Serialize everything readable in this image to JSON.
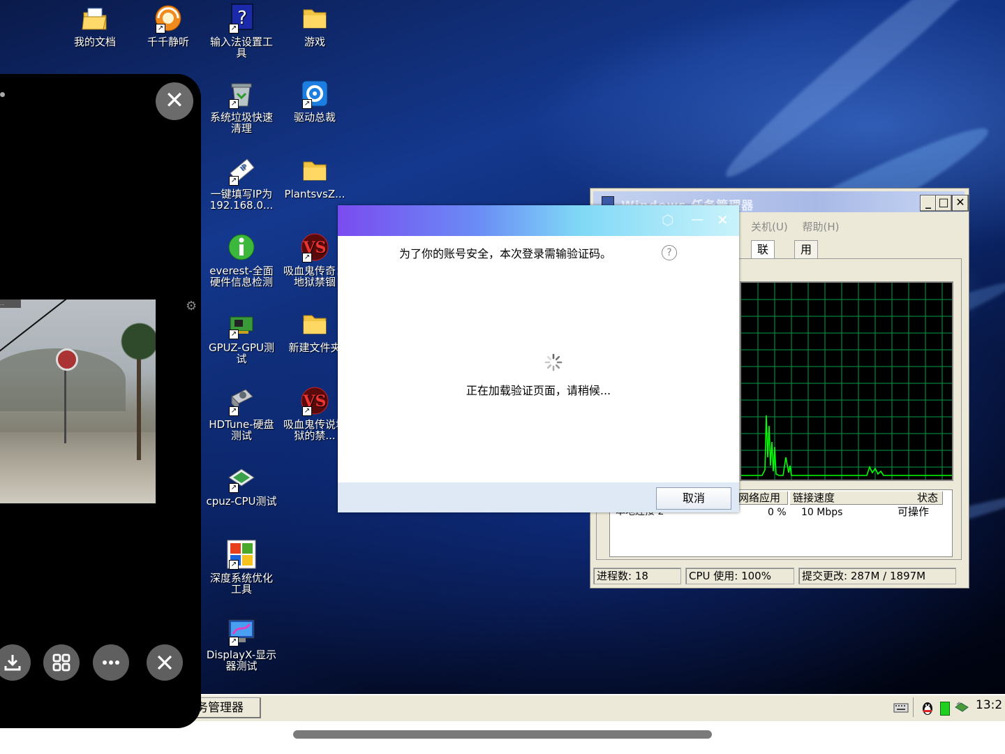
{
  "desktop_icons": [
    {
      "label": "我的文档",
      "icon": "my-documents-icon"
    },
    {
      "label": "千千静听",
      "icon": "music-player-icon"
    },
    {
      "label": "输入法设置工具",
      "icon": "ime-help-icon"
    },
    {
      "label": "游戏",
      "icon": "folder-icon"
    },
    {
      "label": "系统垃圾快速清理",
      "icon": "recycle-bin-icon"
    },
    {
      "label": "驱动总裁",
      "icon": "driver-tool-icon"
    },
    {
      "label": "一键填写IP为192.168.0...",
      "icon": "ip-tool-icon"
    },
    {
      "label": "PlantsvsZ...",
      "icon": "folder-icon"
    },
    {
      "label": "everest-全面硬件信息检测",
      "icon": "info-icon"
    },
    {
      "label": "吸血鬼传奇：地狱禁锢",
      "icon": "game-icon"
    },
    {
      "label": "GPUZ-GPU测试",
      "icon": "gpu-card-icon"
    },
    {
      "label": "新建文件夹",
      "icon": "folder-icon"
    },
    {
      "label": "HDTune-硬盘测试",
      "icon": "hard-disk-icon"
    },
    {
      "label": "吸血鬼传说地狱的禁...",
      "icon": "game-icon"
    },
    {
      "label": "cpuz-CPU测试",
      "icon": "cpu-chip-icon"
    },
    {
      "label": "深度系统优化工具",
      "icon": "windows-logo-icon"
    },
    {
      "label": "DisplayX-显示器测试",
      "icon": "monitor-icon"
    }
  ],
  "overlay": {
    "thumbnail_tag": "...",
    "buttons": [
      "download-icon",
      "grid-icon",
      "more-icon",
      "close-icon"
    ]
  },
  "taskmgr": {
    "title": "Windows 任务管理器",
    "menu": [
      "关机(U)",
      "帮助(H)"
    ],
    "tabs": [
      "联网",
      "用户"
    ],
    "columns": [
      "网络应用",
      "链接速度",
      "状态"
    ],
    "row": {
      "name": "本地连接 2",
      "usage": "0 %",
      "speed": "10 Mbps",
      "state": "可操作"
    },
    "status": {
      "processes": "进程数: 18",
      "cpu": "CPU 使用: 100%",
      "commit": "提交更改: 287M / 1897M"
    },
    "colors": {
      "graph_grid": "#00a04a",
      "graph_line": "#00ff00"
    }
  },
  "dialog": {
    "message": "为了你的账号安全，本次登录需输验证码。",
    "loading": "正在加载验证页面，请稍候...",
    "cancel": "取消",
    "help_glyph": "?",
    "settings_glyph": "⬡",
    "minimize_glyph": "—",
    "close_glyph": "✕"
  },
  "taskbar": {
    "task_item": "务管理器",
    "clock": "13:2"
  }
}
